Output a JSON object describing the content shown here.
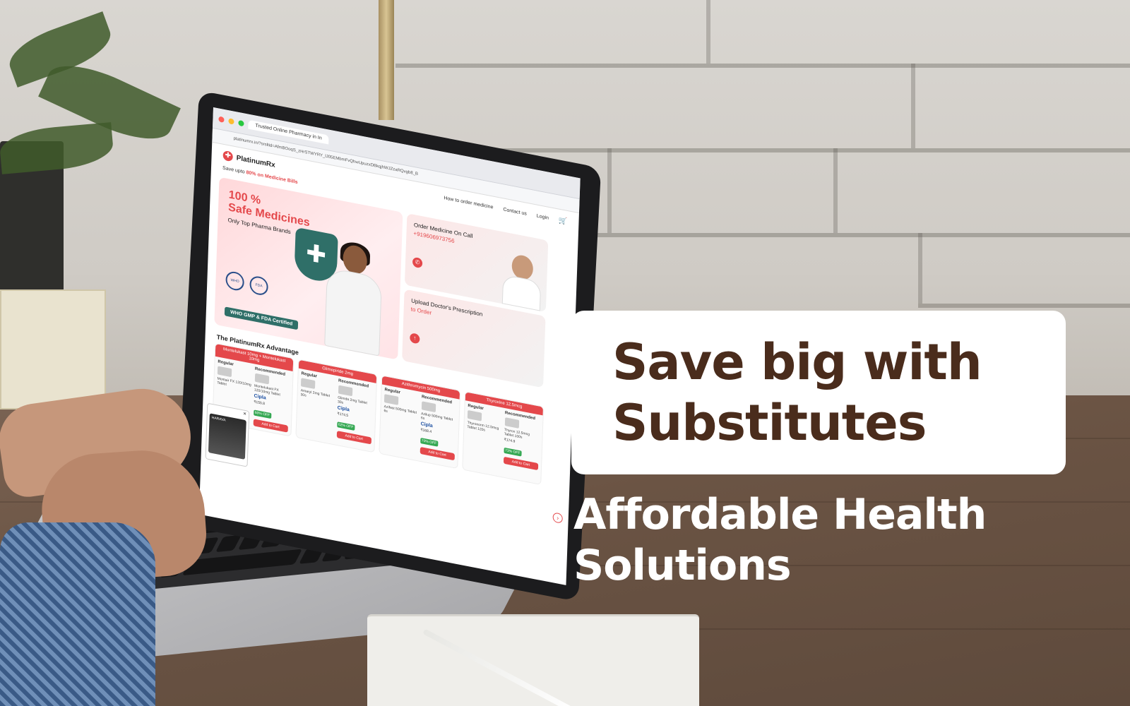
{
  "headline": {
    "line1": "Save big with",
    "line2": "Substitutes"
  },
  "subheadline": {
    "line1": "Affordable Health",
    "line2": "Solutions"
  },
  "screen": {
    "browser": {
      "tab_title": "Trusted Online Pharmacy in In",
      "url": "platinumrx.in/?srsltid=AfmBOoqS_zHrSTWYRY_lJ05EMbmFvQhwUpuzxDBkqjhWJZzaRQvgb8_B"
    },
    "site": {
      "logo": "PlatinumRx",
      "tagline_prefix": "Save upto ",
      "tagline_highlight": "80% on Medicine Bills",
      "nav": [
        "How to order medicine",
        "Contact us",
        "Login"
      ]
    },
    "hero": {
      "kicker": "100 %",
      "title": "Safe Medicines",
      "subtitle": "Only Top Pharma Brands",
      "certification": "WHO GMP & FDA Certified",
      "seal_left": "WHO",
      "seal_right": "FDA"
    },
    "cards": [
      {
        "title": "Order Medicine On Call",
        "detail": "+919606973756"
      },
      {
        "title": "Upload Doctor's Prescription",
        "detail": "to Order"
      }
    ],
    "section_title": "The PlatinumRx Advantage",
    "products": [
      {
        "header": "Montelukast 10mg + Montelukast 10mg",
        "regular": "Regular",
        "recommended": "Recommended",
        "regular_name": "Montair FX 120/10mg Tablet",
        "recommended_name": "Montelukast FX 120/10mg Tablet",
        "brand": "Cipla",
        "price": "₹155.8",
        "off": "60% OFF",
        "add": "Add to Cart"
      },
      {
        "header": "Glimepiride 2mg",
        "regular": "Regular",
        "recommended": "Recommended",
        "regular_name": "Amaryl 2mg Tablet 30s",
        "recommended_name": "Glimda 2mg Tablet 30s",
        "brand": "Cipla",
        "price": "₹174.5",
        "off": "62% OFF",
        "add": "Add to Cart"
      },
      {
        "header": "Azithromycin 500mg",
        "regular": "Regular",
        "recommended": "Recommended",
        "regular_name": "Azifast 500mg Tablet 6s",
        "recommended_name": "Azilup 500mg Tablet 6s",
        "brand": "Cipla",
        "price": "₹168.4",
        "off": "70% OFF",
        "add": "Add to Cart"
      },
      {
        "header": "Thyroxine 12.5mcg",
        "regular": "Regular",
        "recommended": "Recommended",
        "regular_name": "Thyronorm 12.5mcg Tablet 120s",
        "recommended_name": "Thyrox 12.5mcg Tablet 100s",
        "brand": "",
        "price": "₹174.9",
        "off": "73% OFF",
        "add": "Add to Cart"
      }
    ],
    "popup": {
      "close": "✕",
      "text": "HARAVA"
    }
  },
  "icons": {
    "cart": "cart-icon",
    "call": "phone-icon",
    "upload": "upload-icon",
    "prev": "chevron-left-icon",
    "next": "chevron-right-icon"
  },
  "colors": {
    "brand_red": "#e4484b",
    "headline_brown": "#4a2c1c",
    "cipla_blue": "#1c4fa1"
  }
}
